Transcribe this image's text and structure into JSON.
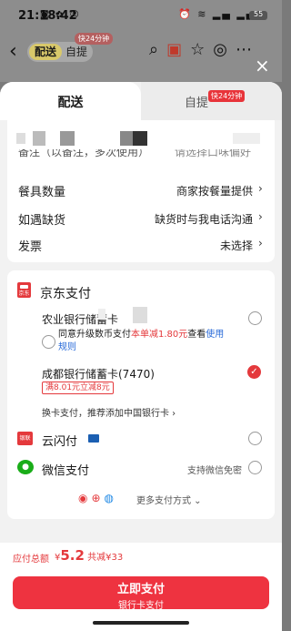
{
  "status": {
    "time": "21:18:42",
    "battery": "55"
  },
  "header": {
    "mode_delivery": "配送",
    "mode_pickup": "自提",
    "pickup_tag": "快24分钟"
  },
  "sheet": {
    "close_icon": "×",
    "tabs": [
      {
        "label": "配送",
        "active": true
      },
      {
        "label": "自提",
        "tag": "快24分钟"
      }
    ],
    "address_cut_text": {
      "left": "备注（以备注，多次使用）",
      "right": "请选择口味偏好"
    },
    "rows": [
      {
        "label": "餐具数量",
        "value": "商家按餐量提供"
      },
      {
        "label": "如遇缺货",
        "value": "缺货时与我电话沟通"
      },
      {
        "label": "发票",
        "value": "未选择"
      }
    ]
  },
  "payment": {
    "jd_pay": {
      "title": "京东支付",
      "logo_text": "京东"
    },
    "methods": [
      {
        "name": "农业银行储蓄卡",
        "selected": false,
        "upgrade_note": {
          "prefix": "同意升级数币支付",
          "discount": "本单减1.80元",
          "middle": "查看",
          "link": "使用规则"
        }
      },
      {
        "name": "成都银行储蓄卡(7470)",
        "selected": true,
        "tag": "满8.01元立减8元"
      }
    ],
    "change_card": "换卡支付，推荐添加中国银行卡",
    "yunshanfu": {
      "title": "云闪付",
      "logo_text": "银联"
    },
    "wechat": {
      "title": "微信支付",
      "note": "支持微信免密"
    },
    "more": "更多支付方式"
  },
  "footer": {
    "total_label": "应付总额",
    "currency": "¥",
    "total_amount": "5.2",
    "saved": "共减¥33",
    "pay_button": "立即支付",
    "pay_sub": "银行卡支付"
  }
}
